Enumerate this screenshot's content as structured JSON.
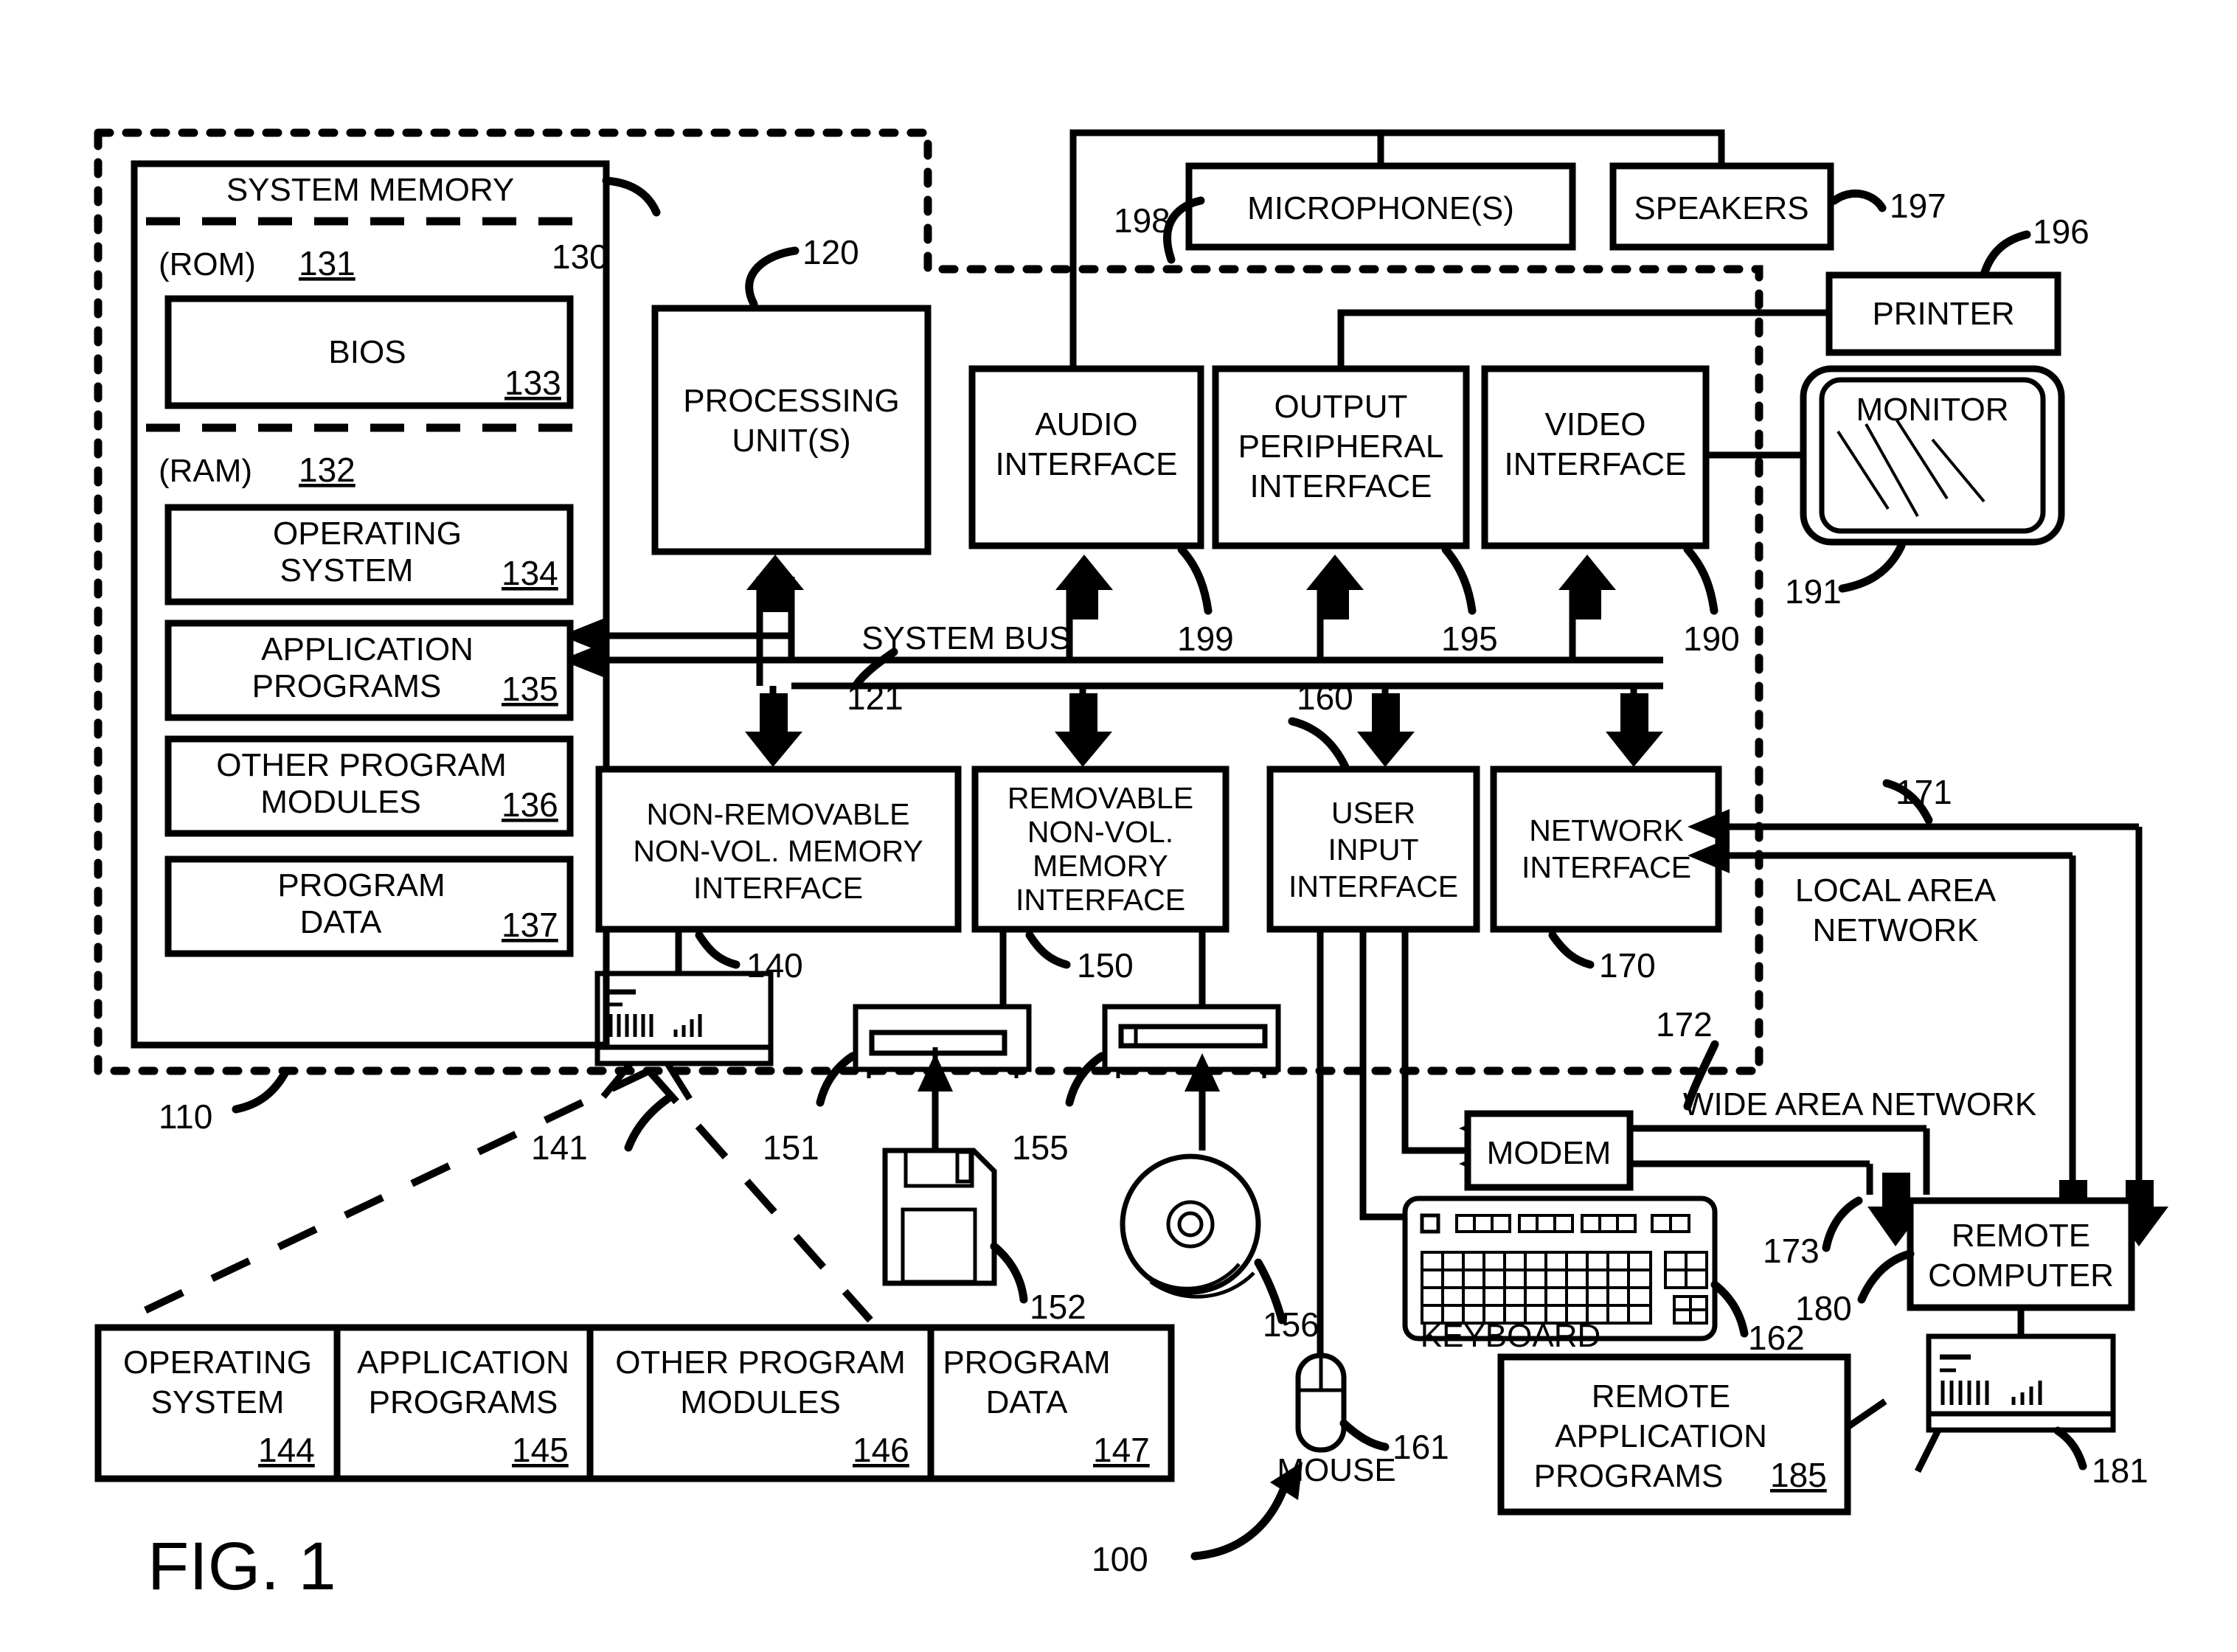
{
  "figure": {
    "label": "FIG. 1",
    "system_ref": "100"
  },
  "boundary": {
    "computer_ref": "110"
  },
  "system_memory": {
    "title": "SYSTEM MEMORY",
    "ref": "130",
    "rom_label": "(ROM)",
    "rom_ref": "131",
    "ram_label": "(RAM)",
    "ram_ref": "132",
    "blocks": [
      {
        "line1": "BIOS",
        "line2": "",
        "ref": "133"
      },
      {
        "line1": "OPERATING",
        "line2": "SYSTEM",
        "ref": "134"
      },
      {
        "line1": "APPLICATION",
        "line2": "PROGRAMS",
        "ref": "135"
      },
      {
        "line1": "OTHER PROGRAM",
        "line2": "MODULES",
        "ref": "136"
      },
      {
        "line1": "PROGRAM",
        "line2": "DATA",
        "ref": "137"
      }
    ]
  },
  "processing_unit": {
    "line1": "PROCESSING",
    "line2": "UNIT(S)",
    "ref": "120"
  },
  "system_bus": {
    "label": "SYSTEM BUS",
    "ref": "121"
  },
  "interfaces_top": [
    {
      "line1": "AUDIO",
      "line2": "INTERFACE",
      "line3": "",
      "ref": "199"
    },
    {
      "line1": "OUTPUT",
      "line2": "PERIPHERAL",
      "line3": "INTERFACE",
      "ref": "195"
    },
    {
      "line1": "VIDEO",
      "line2": "INTERFACE",
      "line3": "",
      "ref": "190"
    }
  ],
  "interfaces_bottom": [
    {
      "line1": "NON-REMOVABLE",
      "line2": "NON-VOL. MEMORY",
      "line3": "INTERFACE",
      "ref": "140"
    },
    {
      "line1": "REMOVABLE",
      "line2": "NON-VOL.",
      "line3": "MEMORY",
      "line4": "INTERFACE",
      "ref": "150"
    },
    {
      "line1": "USER",
      "line2": "INPUT",
      "line3": "INTERFACE",
      "ref": "160"
    },
    {
      "line1": "NETWORK",
      "line2": "INTERFACE",
      "line3": "",
      "ref": "170"
    }
  ],
  "peripherals": {
    "microphone": {
      "label": "MICROPHONE(S)",
      "ref": "198"
    },
    "speakers": {
      "label": "SPEAKERS",
      "ref": "197"
    },
    "printer": {
      "label": "PRINTER",
      "ref": "196"
    },
    "monitor": {
      "label": "MONITOR",
      "ref": "191"
    },
    "keyboard": {
      "label": "KEYBOARD",
      "ref": "162"
    },
    "mouse": {
      "label": "MOUSE",
      "ref": "161"
    },
    "modem": {
      "label": "MODEM",
      "ref": "172"
    }
  },
  "drives": {
    "hard_disk_ref": "141",
    "floppy_drive_ref": "151",
    "floppy_disk_ref": "152",
    "optical_drive_ref": "155",
    "optical_disc_ref": "156"
  },
  "networks": {
    "lan": {
      "line1": "LOCAL AREA",
      "line2": "NETWORK",
      "ref": "171"
    },
    "wan": {
      "label": "WIDE AREA NETWORK",
      "ref": "173"
    }
  },
  "remote": {
    "computer": {
      "line1": "REMOTE",
      "line2": "COMPUTER",
      "ref": "180"
    },
    "computer_icon_ref": "181",
    "apps": {
      "line1": "REMOTE",
      "line2": "APPLICATION",
      "line3": "PROGRAMS",
      "ref": "185"
    }
  },
  "storage_table": {
    "cells": [
      {
        "line1": "OPERATING",
        "line2": "SYSTEM",
        "ref": "144"
      },
      {
        "line1": "APPLICATION",
        "line2": "PROGRAMS",
        "ref": "145"
      },
      {
        "line1": "OTHER PROGRAM",
        "line2": "MODULES",
        "ref": "146"
      },
      {
        "line1": "PROGRAM",
        "line2": "DATA",
        "ref": "147"
      }
    ]
  }
}
